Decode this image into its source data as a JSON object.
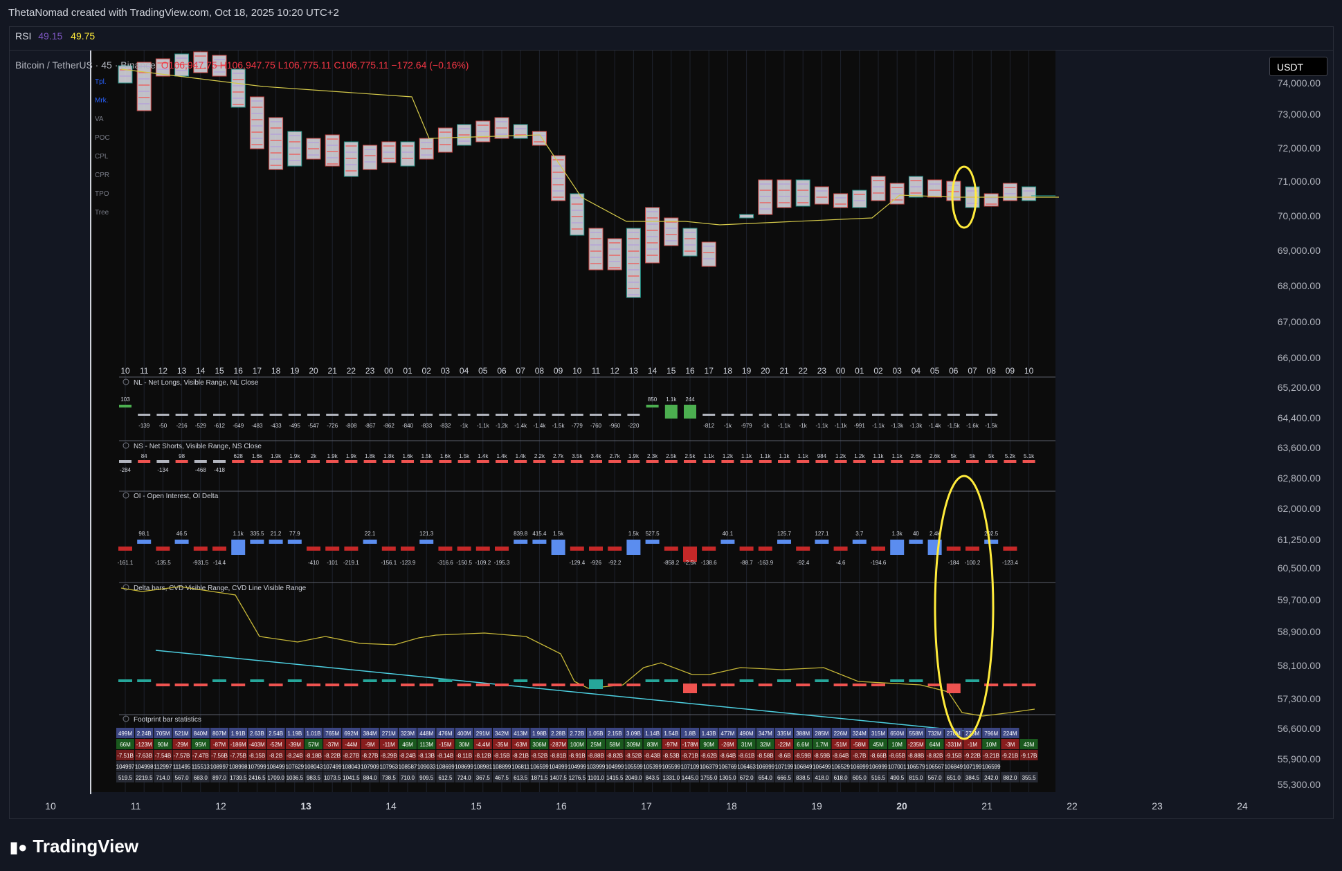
{
  "header": {
    "attribution": "ThetaNomad created with TradingView.com, Oct 18, 2025 10:20 UTC+2"
  },
  "rsi": {
    "label": "RSI",
    "value1": "49.15",
    "value2": "49.75"
  },
  "symbol": {
    "name": "Bitcoin / TetherUS · 45 · Binance",
    "ohlc": "O106,947.75 H106,947.75 L106,775.11 C106,775.11 −172.64 (−0.16%)"
  },
  "currency_button": "USDT",
  "toolbar": {
    "items": [
      "Tpl.",
      "Mrk.",
      "VA",
      "POC",
      "CPL",
      "CPR",
      "TPO",
      "Tree"
    ]
  },
  "price_axis": [
    "74,000.00",
    "73,000.00",
    "72,000.00",
    "71,000.00",
    "70,000.00",
    "69,000.00",
    "68,000.00",
    "67,000.00",
    "66,000.00",
    "65,200.00",
    "64,400.00",
    "63,600.00",
    "62,800.00",
    "62,000.00",
    "61,250.00",
    "60,500.00",
    "59,700.00",
    "58,900.00",
    "58,100.00",
    "57,300.00",
    "56,600.00",
    "55,900.00",
    "55,300.00"
  ],
  "hour_labels": [
    "10",
    "11",
    "12",
    "13",
    "14",
    "15",
    "16",
    "17",
    "18",
    "19",
    "20",
    "21",
    "22",
    "23",
    "00",
    "01",
    "02",
    "03",
    "04",
    "05",
    "06",
    "07",
    "08",
    "09",
    "10",
    "11",
    "12",
    "13",
    "14",
    "15",
    "16",
    "17",
    "18",
    "19",
    "20",
    "21",
    "22",
    "23",
    "00",
    "01",
    "02",
    "03",
    "04",
    "05",
    "06",
    "07",
    "08",
    "09",
    "10"
  ],
  "date_axis": [
    "10",
    "11",
    "12",
    "13",
    "14",
    "15",
    "16",
    "17",
    "18",
    "19",
    "20",
    "21",
    "22",
    "23",
    "24"
  ],
  "panes": {
    "nl": {
      "title": "NL - Net Longs, Visible Range, NL Close",
      "labels": [
        "103",
        "-139",
        "-50",
        "-216",
        "-529",
        "-612",
        "-649",
        "-483",
        "-433",
        "-495",
        "-547",
        "-726",
        "-808",
        "-867",
        "-862",
        "-840",
        "-833",
        "-832",
        "-1k",
        "-1.1k",
        "-1.2k",
        "-1.4k",
        "-1.4k",
        "-1.5k",
        "-779",
        "-760",
        "-960",
        "-220",
        "850",
        "1.1k",
        "244",
        "-812",
        "-1k",
        "-979",
        "-1k",
        "-1.1k",
        "-1k",
        "-1.1k",
        "-1.1k",
        "-991",
        "-1.1k",
        "-1.3k",
        "-1.3k",
        "-1.4k",
        "-1.5k",
        "-1.6k",
        "-1.5k"
      ]
    },
    "ns": {
      "title": "NS - Net Shorts, Visible Range, NS Close",
      "labels": [
        "-284",
        "84",
        "-134",
        "98",
        "-468",
        "-418",
        "628",
        "1.6k",
        "1.9k",
        "1.9k",
        "2k",
        "1.9k",
        "1.9k",
        "1.8k",
        "1.8k",
        "1.6k",
        "1.5k",
        "1.6k",
        "1.5k",
        "1.4k",
        "1.4k",
        "1.4k",
        "2.2k",
        "2.7k",
        "3.5k",
        "3.4k",
        "2.7k",
        "1.9k",
        "2.3k",
        "2.5k",
        "2.5k",
        "1.1k",
        "1.2k",
        "1.1k",
        "1.1k",
        "1.1k",
        "1.1k",
        "984",
        "1.2k",
        "1.2k",
        "1.1k",
        "1.1k",
        "2.6k",
        "2.6k",
        "5k",
        "5k",
        "5k",
        "5.2k",
        "5.1k"
      ]
    },
    "oi": {
      "title": "OI - Open Interest, OI Delta",
      "labels": [
        "-161.1",
        "98.1",
        "-135.5",
        "46.5",
        "-931.5",
        "-14.4",
        "1.1k",
        "335.5",
        "21.2",
        "77.9",
        "-410",
        "-101",
        "-219.1",
        "22.1",
        "-156.1",
        "-123.9",
        "121.3",
        "-316.6",
        "-150.5",
        "-109.2",
        "-195.3",
        "839.8",
        "415.4",
        "1.5k",
        "-129.4",
        "-926",
        "-92.2",
        "1.5k",
        "527.5",
        "-858.2",
        "-2.5k",
        "-138.6",
        "40.1",
        "-88.7",
        "-163.9",
        "125.7",
        "-92.4",
        "127.1",
        "-4.6",
        "3.7",
        "-194.6",
        "1.3k",
        "40",
        "2.4k",
        "-184",
        "-100.2",
        "202.5",
        "-123.4"
      ]
    },
    "delta": {
      "title": "Delta bars, CVD Visible Range, CVD Line Visible Range"
    },
    "footprint": {
      "title": "Footprint bar statistics",
      "rows": [
        [
          "499M",
          "2.24B",
          "705M",
          "521M",
          "840M",
          "807M",
          "1.91B",
          "2.63B",
          "2.54B",
          "1.19B",
          "1.01B",
          "765M",
          "692M",
          "384M",
          "271M",
          "323M",
          "448M",
          "476M",
          "400M",
          "291M",
          "342M",
          "413M",
          "1.98B",
          "2.28B",
          "2.72B",
          "1.05B",
          "2.15B",
          "3.09B",
          "1.14B",
          "1.54B",
          "1.8B",
          "1.43B",
          "477M",
          "490M",
          "347M",
          "335M",
          "388M",
          "285M",
          "226M",
          "324M",
          "315M",
          "650M",
          "558M",
          "732M",
          "278M",
          "278M",
          "796M",
          "224M"
        ],
        [
          "66M",
          "-123M",
          "90M",
          "-29M",
          "95M",
          "-87M",
          "-186M",
          "-403M",
          "-52M",
          "-39M",
          "57M",
          "-37M",
          "-44M",
          "-9M",
          "-11M",
          "46M",
          "113M",
          "-15M",
          "30M",
          "-4.4M",
          "-35M",
          "-63M",
          "306M",
          "-287M",
          "100M",
          "25M",
          "58M",
          "309M",
          "83M",
          "-97M",
          "-178M",
          "90M",
          "-26M",
          "31M",
          "32M",
          "-22M",
          "6.6M",
          "1.7M",
          "-51M",
          "-58M",
          "45M",
          "10M",
          "-235M",
          "64M",
          "-331M",
          "-1M",
          "10M",
          "-3M",
          "43M"
        ],
        [
          "-7.51B",
          "-7.63B",
          "-7.54B",
          "-7.57B",
          "-7.47B",
          "-7.56B",
          "-7.75B",
          "-8.15B",
          "-8.2B",
          "-8.24B",
          "-8.18B",
          "-8.22B",
          "-8.27B",
          "-8.27B",
          "-8.29B",
          "-8.24B",
          "-8.13B",
          "-8.14B",
          "-8.11B",
          "-8.12B",
          "-8.15B",
          "-8.21B",
          "-8.52B",
          "-8.81B",
          "-8.91B",
          "-8.88B",
          "-8.82B",
          "-8.52B",
          "-8.43B",
          "-8.53B",
          "-8.71B",
          "-8.62B",
          "-8.64B",
          "-8.61B",
          "-8.58B",
          "-8.6B",
          "-8.59B",
          "-8.59B",
          "-8.64B",
          "-8.7B",
          "-8.66B",
          "-8.65B",
          "-8.88B",
          "-8.82B",
          "-9.15B",
          "-9.22B",
          "-9.21B",
          "-9.21B",
          "-9.17B"
        ],
        [
          "104997",
          "104998",
          "112997",
          "111495",
          "115513",
          "108997",
          "108998",
          "107999",
          "108499",
          "107629",
          "108043",
          "107499",
          "108043",
          "107909",
          "107963",
          "108587",
          "109033",
          "108699",
          "108699",
          "108981",
          "108899",
          "106811",
          "106599",
          "104999",
          "104999",
          "103999",
          "104999",
          "105599",
          "105399",
          "105599",
          "107109",
          "106379",
          "106769",
          "106463",
          "106999",
          "107199",
          "106849",
          "106499",
          "106529",
          "106999",
          "106999",
          "107001",
          "106579",
          "106567",
          "106849",
          "107199",
          "106599"
        ],
        [
          "519.5",
          "2219.5",
          "714.0",
          "567.0",
          "683.0",
          "897.0",
          "1739.5",
          "2416.5",
          "1709.0",
          "1036.5",
          "983.5",
          "1073.5",
          "1041.5",
          "884.0",
          "738.5",
          "710.0",
          "909.5",
          "612.5",
          "724.0",
          "367.5",
          "467.5",
          "613.5",
          "1871.5",
          "1407.5",
          "1276.5",
          "1101.0",
          "1415.5",
          "2049.0",
          "843.5",
          "1331.0",
          "1445.0",
          "1755.0",
          "1305.0",
          "672.0",
          "654.0",
          "666.5",
          "838.5",
          "418.0",
          "618.0",
          "605.0",
          "516.5",
          "490.5",
          "815.0",
          "567.0",
          "651.0",
          "384.5",
          "242.0",
          "882.0",
          "355.5"
        ]
      ]
    }
  },
  "brand": "TradingView"
}
